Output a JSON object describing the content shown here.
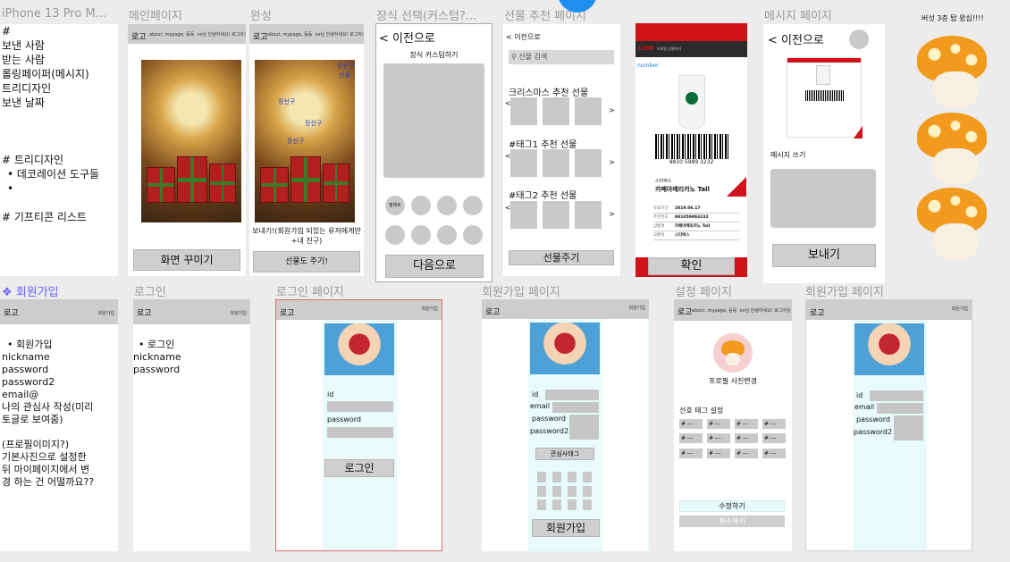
{
  "frame_titles": {
    "iphone": "iPhone 13 Pro M...",
    "main": "메인페이지",
    "complete": "완성",
    "decor": "장식 선택(커스텀?...",
    "gift_rec": "선물 추천 페이지",
    "message": "메시지 페이지",
    "signup_note": "회원가입",
    "login_note": "로그인",
    "login_page": "로그인 페이지",
    "signup_page": "회원가입 페이지",
    "settings": "설정 페이지",
    "signup_page2": "회원가입 페이지"
  },
  "iphone_note": {
    "lines": [
      "#",
      "보낸 사람",
      "받는 사람",
      "롤링페이퍼(메시지)",
      "트리디자인",
      "보낸 날짜"
    ],
    "section2": "# 트리디자인",
    "bullet1": "데코레이션 도구들",
    "bullet2": "",
    "section3": "# 기프티콘 리스트"
  },
  "header": {
    "logo": "로고",
    "menu": "about, mypage, 등등",
    "greeting": "xx님 안녕하세요! 로그아웃",
    "signup_link": "회원가입"
  },
  "main_page": {
    "button": "화면 꾸미기"
  },
  "complete_page": {
    "stickers": [
      "장신구",
      "선물",
      "장신구",
      "장신구",
      "장신구"
    ],
    "note": "보내기!(회원가입 되있는 유저에게만+내 친구)",
    "button": "선물도 주기!"
  },
  "decor_page": {
    "back": "< 이전으로",
    "subtitle": "장식 커스텀하기",
    "palette": "팔레트",
    "button": "다음으로"
  },
  "gift_page": {
    "back": "< 이전으로",
    "search_placeholder": "선물 검색",
    "sections": [
      "크리스마스 추천 선물",
      "#태그1 추천 선물",
      "#태그2 추천 선물"
    ],
    "prev": "<",
    "next": ">",
    "button": "선물주기"
  },
  "gifticon": {
    "brand": "CON",
    "brand_sub": "모바일 선물하기",
    "number_label": "number",
    "barcode_number": "9810 5989 3232",
    "store": "스타벅스",
    "product": "카페아메리카노 Tall",
    "rows": [
      {
        "k": "유효기간",
        "v": "2019.06.17"
      },
      {
        "k": "주문번호",
        "v": "981059893232"
      },
      {
        "k": "상품명",
        "v": "카페아메리카노 Tall"
      },
      {
        "k": "교환처",
        "v": "스타벅스"
      }
    ],
    "button": "확인"
  },
  "message_page": {
    "back": "< 이전으로",
    "label": "메시지 쓰기",
    "button": "보내기"
  },
  "mushroom_caption": "버섯 3층 탑 왔심!!!!",
  "signup_note": {
    "bullet": "회원가입",
    "lines": [
      "nickname",
      "password",
      "password2",
      "email@",
      "나의 관심사 작성(미리",
      "토글로 보여줌)",
      "",
      "(프로필이미지?)",
      "기본사진으로 설정한",
      "뒤 마이페이지에서 변",
      "경 하는 건 어떨까요??"
    ]
  },
  "login_note": {
    "bullet": "로그인",
    "lines": [
      "nickname",
      "password"
    ]
  },
  "login_page": {
    "id_label": "id",
    "password_label": "password",
    "button": "로그인"
  },
  "signup_page": {
    "id_label": "id",
    "email_label": "email",
    "password_label": "password",
    "password2_label": "password2",
    "tag_button": "관심사태그",
    "button": "회원가입"
  },
  "settings_page": {
    "profile_change": "프로필 사진변경",
    "tag_label": "선호 태그 설정",
    "tag": "# ---",
    "save": "수정하기",
    "cancel": "취소하기"
  },
  "signup_page2": {
    "id_label": "id",
    "email_label": "email",
    "password_label": "password",
    "password2_label": "password2"
  },
  "colors": {
    "canvas": "#ececec",
    "frame_title": "#9a9a9a",
    "selected": "#6c63ff",
    "cyan": "#e8fbfa",
    "gifticon_red": "#d0121b"
  }
}
